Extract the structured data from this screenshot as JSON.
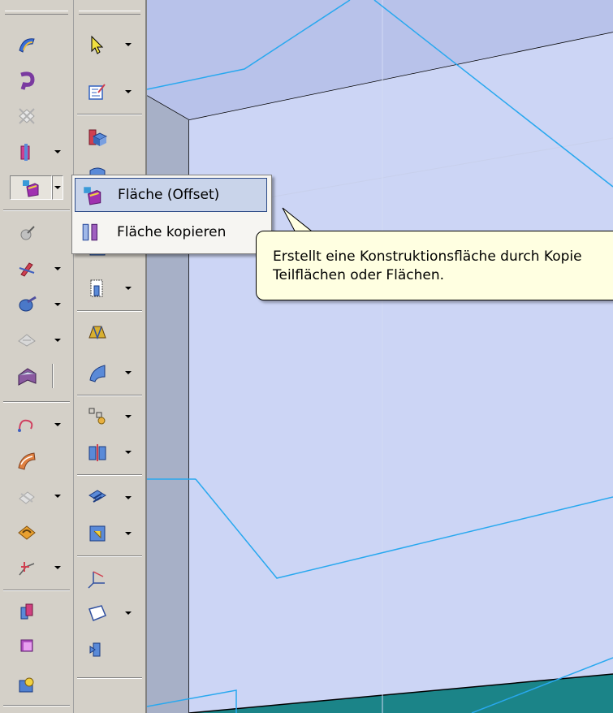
{
  "dropdown": {
    "items": [
      {
        "label": "Fläche (Offset)",
        "icon": "offset-surface-icon",
        "selected": true
      },
      {
        "label": "Fläche kopieren",
        "icon": "copy-surface-icon",
        "selected": false
      }
    ]
  },
  "tooltip": {
    "line1": "Erstellt eine Konstruktionsfläche durch Kopie",
    "line2": "Teilflächen oder Flächen."
  },
  "toolbar_left": {
    "icons": [
      "sweep-surface-icon",
      "extruded-surface-icon",
      "swept-cutout-icon",
      "split-surface-icon",
      "offset-surface-icon",
      "bounded-surface-icon",
      "trim-surface-icon",
      "intersect-surface-icon",
      "stitched-surface-icon",
      "swept-protrusion-icon",
      "curve-icon",
      "blend-surface-icon",
      "derived-curve-icon",
      "round-icon",
      "cross-curve-icon",
      "replace-face-icon",
      "thicken-icon",
      "keypoint-curve-icon"
    ]
  },
  "toolbar_right": {
    "icons": [
      "select-arrow-icon",
      "sketch-icon",
      "protrusion-icon",
      "revolve-icon",
      "cutout-icon",
      "hole-icon",
      "loft-icon",
      "sweep-icon",
      "pattern-icon",
      "mirror-icon",
      "rib-icon",
      "web-icon",
      "coordinate-system-icon",
      "plane-icon",
      "wrap-icon"
    ]
  },
  "colors": {
    "viewport_bg": "#1d8a8e",
    "part_face": "#ccd5f5",
    "part_side": "#a7b0c7",
    "edge_highlight": "#28a8ef",
    "tooltip_bg": "#ffffe1",
    "menu_selected": "#c9d4ea"
  }
}
